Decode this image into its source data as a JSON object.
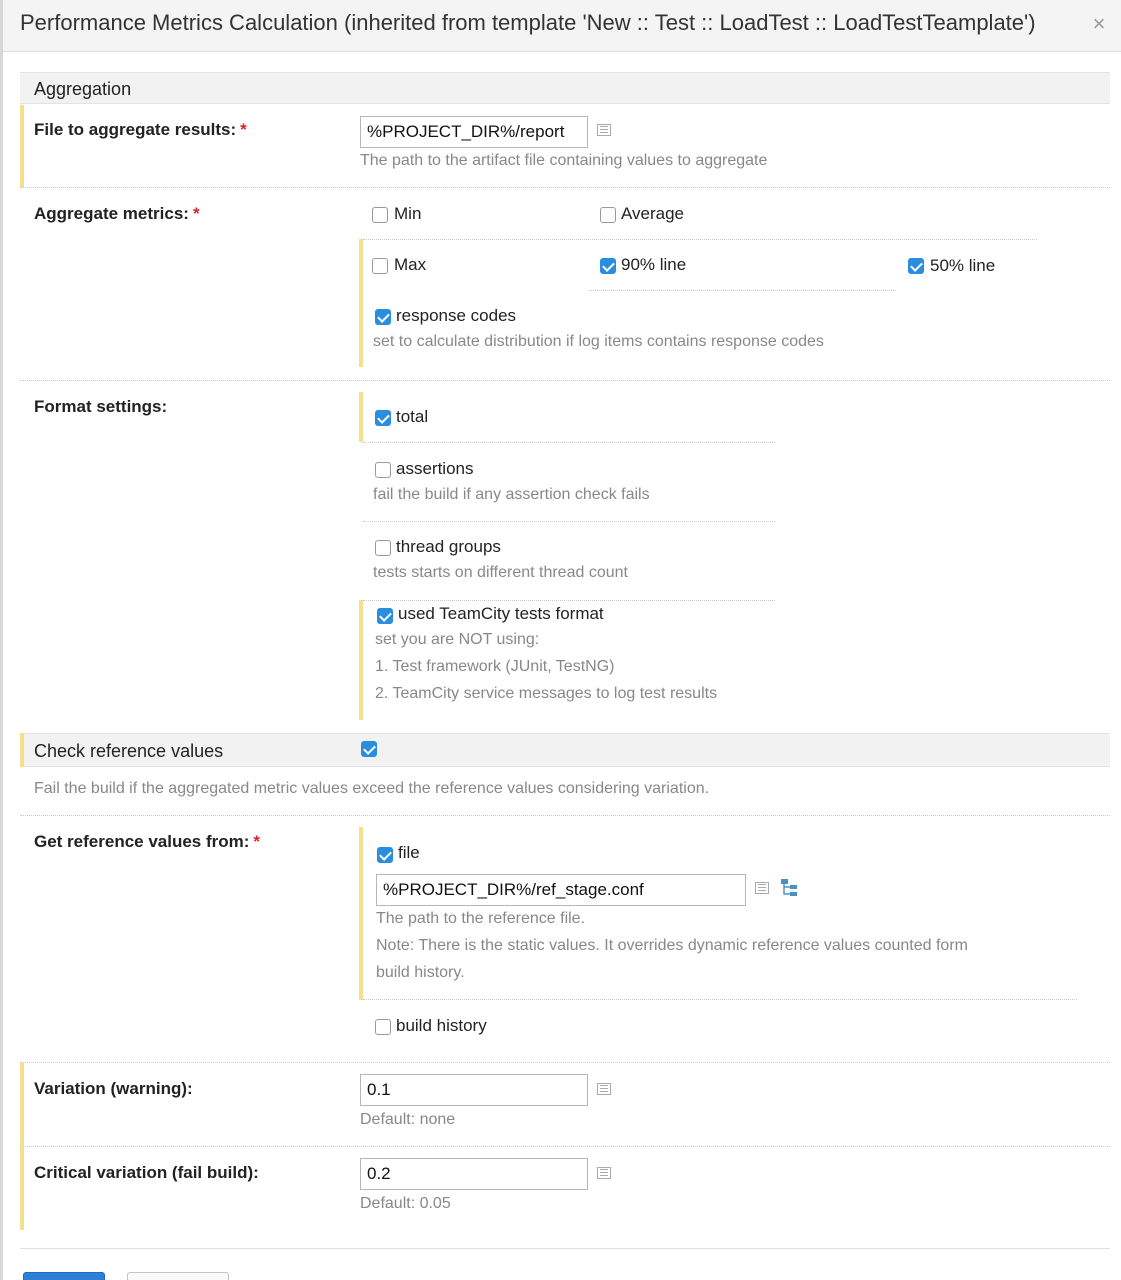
{
  "dialog": {
    "title": "Performance Metrics Calculation (inherited from template 'New :: Test :: LoadTest :: LoadTestTeamplate')",
    "close_glyph": "×"
  },
  "aggregation": {
    "header": "Aggregation",
    "file_label": "File to aggregate results:",
    "file_value": "%PROJECT_DIR%/report",
    "file_note": "The path to the artifact file containing values to aggregate",
    "metrics_label": "Aggregate metrics:",
    "metrics": {
      "min": {
        "label": "Min",
        "checked": false
      },
      "average": {
        "label": "Average",
        "checked": false
      },
      "max": {
        "label": "Max",
        "checked": false
      },
      "line90": {
        "label": "90% line",
        "checked": true
      },
      "line50": {
        "label": "50% line",
        "checked": true
      },
      "response_codes": {
        "label": "response codes",
        "checked": true,
        "note": "set to calculate distribution if log items contains response codes"
      }
    },
    "format_label": "Format settings:",
    "format": {
      "total": {
        "label": "total",
        "checked": true
      },
      "assertions": {
        "label": "assertions",
        "checked": false,
        "note": "fail the build if any assertion check fails"
      },
      "thread_groups": {
        "label": "thread groups",
        "checked": false,
        "note": "tests starts on different thread count"
      },
      "teamcity_format": {
        "label": "used TeamCity tests format",
        "checked": true,
        "note1": "set you are NOT using:",
        "note2": "1. Test framework (JUnit, TestNG)",
        "note3": "2. TeamCity service messages to log test results"
      }
    }
  },
  "reference": {
    "header": "Check reference values",
    "checked": true,
    "note": "Fail the build if the aggregated metric values exceed the reference values considering variation.",
    "get_label": "Get reference values from:",
    "file": {
      "label": "file",
      "checked": true,
      "value": "%PROJECT_DIR%/ref_stage.conf",
      "note1": "The path to the reference file.",
      "note2": "Note: There is the static values. It overrides dynamic reference values counted form",
      "note3": "build history."
    },
    "build_history": {
      "label": "build history",
      "checked": false
    },
    "variation_label": "Variation (warning):",
    "variation_value": "0.1",
    "variation_default": "Default: none",
    "critical_label": "Critical variation (fail build):",
    "critical_value": "0.2",
    "critical_default": "Default: 0.05"
  },
  "icons": {
    "close": "close-icon",
    "list": "list-icon",
    "tree": "tree-icon",
    "required": "*"
  },
  "colors": {
    "checkbox_on": "#2a8ee0",
    "required": "#d8252a",
    "modified_bar": "#f5e08a",
    "primary_button": "#2d7fd6"
  }
}
